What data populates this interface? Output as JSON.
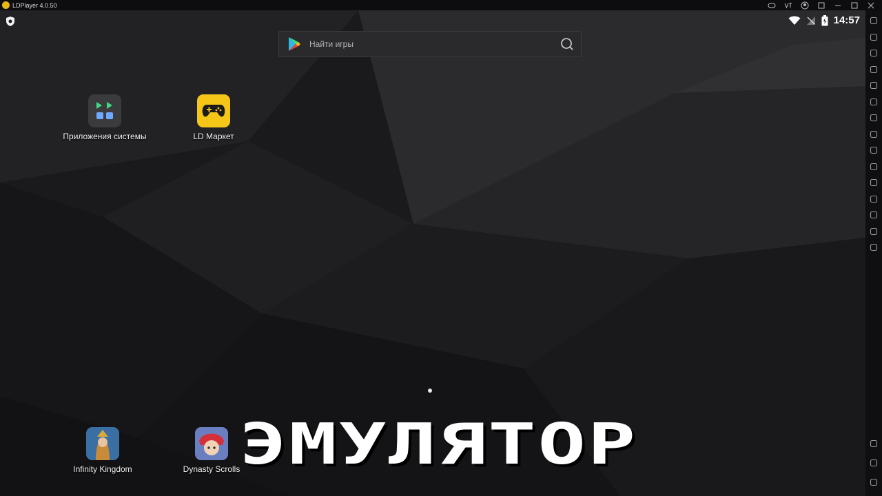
{
  "window": {
    "title": "LDPlayer 4.0.50"
  },
  "status_bar": {
    "time": "14:57"
  },
  "search": {
    "placeholder": "Найти игры"
  },
  "apps_top": [
    {
      "label": "Приложения системы",
      "icon": "system-apps-folder-icon"
    },
    {
      "label": "LD Маркет",
      "icon": "gamepad-icon"
    }
  ],
  "apps_bottom": [
    {
      "label": "Infinity Kingdom",
      "icon": "infinity-kingdom-game-icon"
    },
    {
      "label": "Dynasty Scrolls",
      "icon": "dynasty-scrolls-game-icon"
    }
  ],
  "overlay_text": "ЭМУЛЯТОР",
  "sidebar_icons": [
    "settings-icon",
    "keyboard-icon",
    "volume-up-icon",
    "volume-down-icon",
    "fullscreen-icon",
    "rotate-icon",
    "screenshot-icon",
    "multi-instance-icon",
    "scissors-icon",
    "video-record-icon",
    "apk-install-icon",
    "gear-icon",
    "folder-icon",
    "location-icon",
    "sync-icon"
  ],
  "sidebar_bottom_icons": [
    "back-icon",
    "home-icon",
    "recent-apps-icon"
  ],
  "colors": {
    "accent": "#e8b913",
    "background": "#1b1b1d",
    "search_bg": "#2a2a2c",
    "sidebar_bg": "#0f0f11"
  }
}
